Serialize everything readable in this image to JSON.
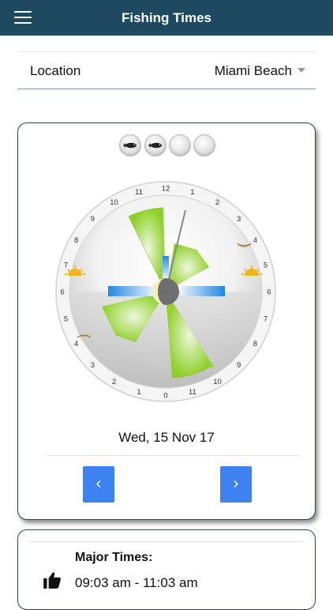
{
  "app": {
    "title": "Fishing Times"
  },
  "location": {
    "label": "Location",
    "value": "Miami Beach"
  },
  "dial": {
    "hour_labels_top": [
      "12",
      "1",
      "2",
      "3",
      "4",
      "5",
      "6",
      "7",
      "8",
      "9",
      "10",
      "11"
    ],
    "hour_labels_bottom": [
      "0",
      "1",
      "2",
      "3",
      "4",
      "5",
      "6",
      "7",
      "8",
      "9",
      "10",
      "11"
    ]
  },
  "rating": {
    "filled": 2,
    "total": 4
  },
  "day": {
    "date": "Wed, 15 Nov 17",
    "prev_label": "‹",
    "next_label": "›"
  },
  "major": {
    "title": "Major Times:",
    "time": "09:03 am - 11:03 am"
  },
  "colors": {
    "navbar": "#1d4a60",
    "button": "#3f81f0",
    "wedge": "#8fd12a",
    "marker": "#1e88e5"
  }
}
